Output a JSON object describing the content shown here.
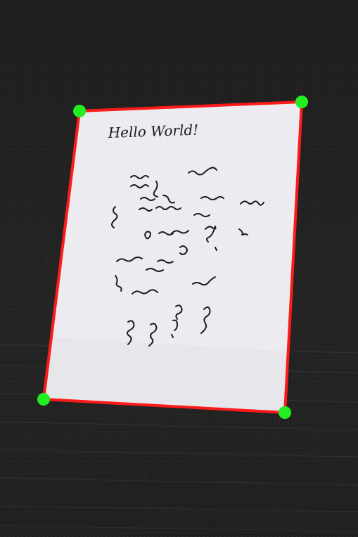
{
  "document": {
    "heading": "Hello World!"
  },
  "corners": [
    {
      "id": "top-left"
    },
    {
      "id": "top-right"
    },
    {
      "id": "bottom-right"
    },
    {
      "id": "bottom-left"
    }
  ],
  "colors": {
    "background": "#232323",
    "carpet_stripe": "#2c2c2c",
    "paper": "#ececf0",
    "paper_shadow": "#d8d8de",
    "outline": "#ff1a1a",
    "handle": "#22ee22",
    "ink": "#1c1c1c"
  }
}
